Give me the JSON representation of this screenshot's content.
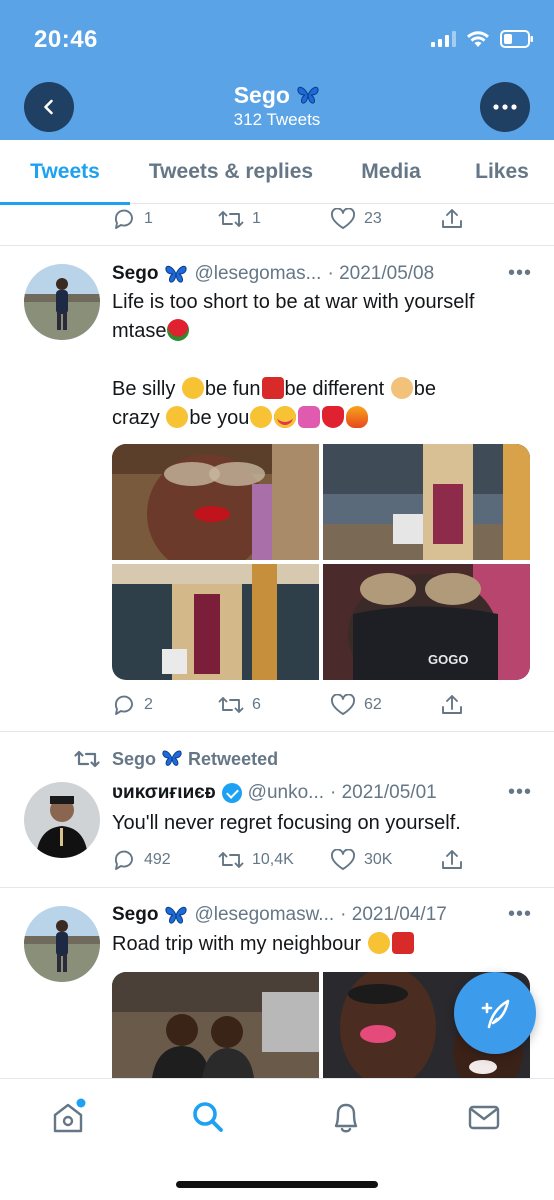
{
  "status_bar": {
    "time": "20:46"
  },
  "header": {
    "name": "Sego",
    "tweet_count": "312 Tweets"
  },
  "tabs": [
    {
      "label": "Tweets",
      "active": true
    },
    {
      "label": "Tweets & replies",
      "active": false
    },
    {
      "label": "Media",
      "active": false
    },
    {
      "label": "Likes",
      "active": false
    }
  ],
  "top_actions": {
    "replies": "1",
    "retweets": "1",
    "likes": "23"
  },
  "tweets": [
    {
      "name": "Sego",
      "handle": "@lesegomas...",
      "date": "· 2021/05/08",
      "text_line1": "Life is too short to be at war with yourself",
      "text_line2": "mtase",
      "text_line3a": "Be silly ",
      "text_line3b": "be fun",
      "text_line3c": "be different ",
      "text_line3d": "be",
      "text_line4a": "crazy ",
      "text_line4b": "be you",
      "media_count": 4,
      "media_caption": "GOGO",
      "replies": "2",
      "retweets": "6",
      "likes": "62"
    },
    {
      "retweeted_by": "Sego",
      "retweeted_label": "Retweeted",
      "name": "ʋиκσиғιиєᴆ",
      "handle": "@unko...",
      "date": "· 2021/05/01",
      "text": "You'll never regret focusing on yourself.",
      "replies": "492",
      "retweets": "10,4K",
      "likes": "30K"
    },
    {
      "name": "Sego",
      "handle": "@lesegomasw...",
      "date": "· 2021/04/17",
      "text": "Road trip with my neighbour ",
      "media_count": 2
    }
  ],
  "icons": {
    "back": "chevron-left-icon",
    "more": "more-horizontal-icon",
    "reply": "reply-icon",
    "retweet": "retweet-icon",
    "like": "heart-icon",
    "share": "share-icon",
    "compose": "compose-tweet-icon",
    "home": "home-icon",
    "search": "search-icon",
    "notifications": "bell-icon",
    "messages": "mail-icon",
    "butterfly": "butterfly-emoji",
    "verified": "verified-badge-icon"
  },
  "colors": {
    "header_bg": "#5aa3e6",
    "accent": "#1da1f2",
    "muted": "#657786",
    "button_dark": "#1f3f63"
  }
}
